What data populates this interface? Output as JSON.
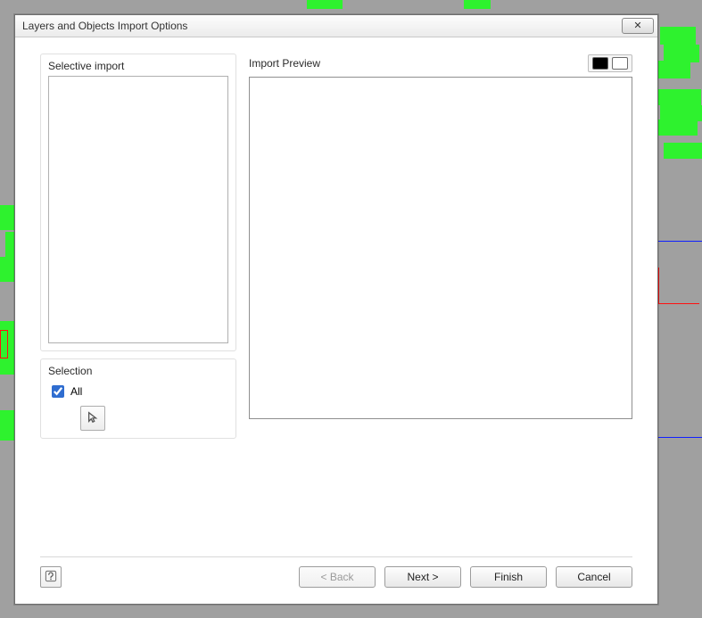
{
  "window": {
    "title": "Layers and Objects Import Options",
    "close_glyph": "✕"
  },
  "left": {
    "selective_import_label": "Selective import",
    "selection_label": "Selection",
    "all_checkbox_label": "All",
    "all_checked": true
  },
  "right": {
    "preview_label": "Import Preview",
    "swatch_dark": "dark-background",
    "swatch_light": "light-background"
  },
  "footer": {
    "back_label": "< Back",
    "next_label": "Next >",
    "finish_label": "Finish",
    "cancel_label": "Cancel",
    "back_enabled": false
  }
}
